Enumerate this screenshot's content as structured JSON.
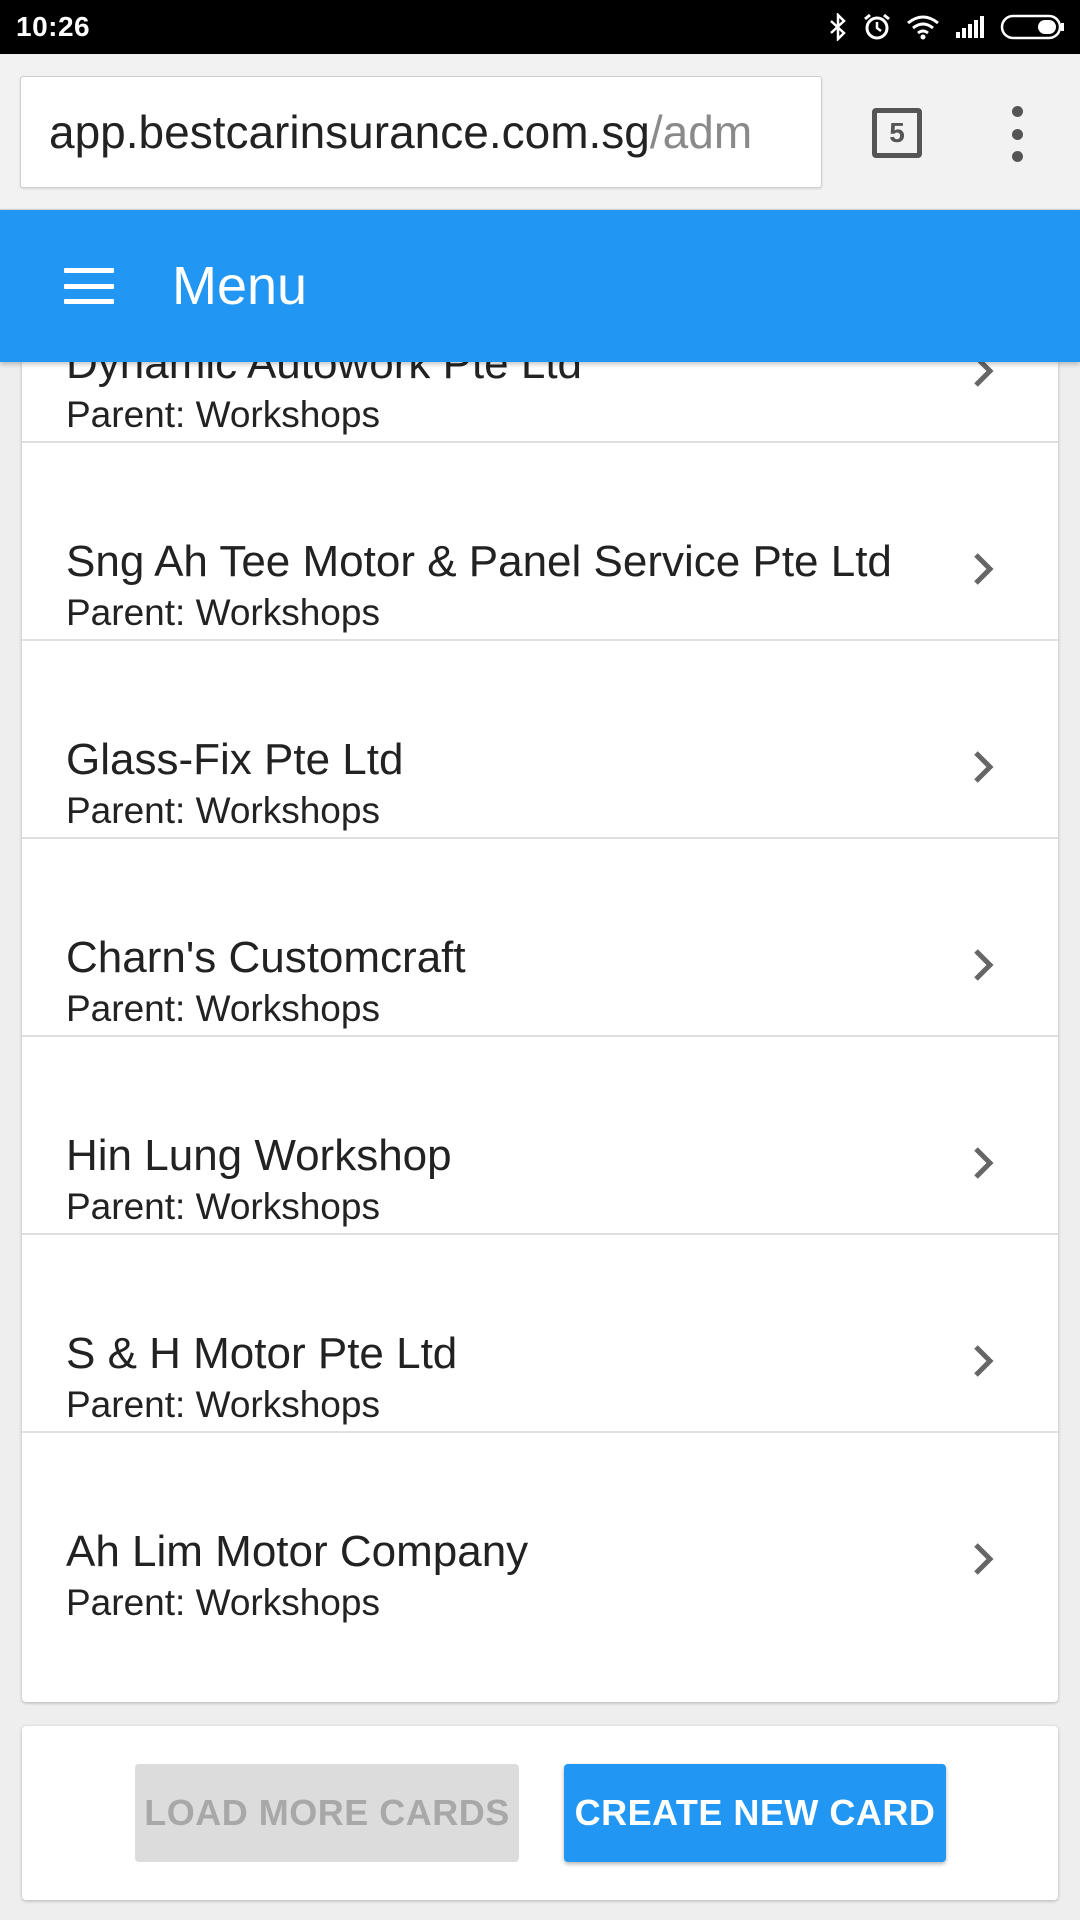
{
  "status_bar": {
    "time": "10:26"
  },
  "browser": {
    "url_host": "app.bestcarinsurance.com.sg",
    "url_rest": "/adm",
    "tab_count": "5"
  },
  "app_bar": {
    "title": "Menu"
  },
  "list": {
    "items": [
      {
        "title": "Dynamic Autowork Pte Ltd",
        "subtitle": "Parent: Workshops"
      },
      {
        "title": "Sng Ah Tee Motor & Panel Service Pte Ltd",
        "subtitle": "Parent: Workshops"
      },
      {
        "title": "Glass-Fix Pte Ltd",
        "subtitle": "Parent: Workshops"
      },
      {
        "title": "Charn's Customcraft",
        "subtitle": "Parent: Workshops"
      },
      {
        "title": "Hin Lung Workshop",
        "subtitle": "Parent: Workshops"
      },
      {
        "title": "S & H Motor Pte Ltd",
        "subtitle": "Parent: Workshops"
      },
      {
        "title": "Ah Lim Motor Company",
        "subtitle": "Parent: Workshops"
      }
    ]
  },
  "actions": {
    "load_more_label": "LOAD MORE CARDS",
    "create_label": "CREATE NEW CARD"
  },
  "colors": {
    "accent": "#2196f3",
    "disabled_button": "#dcdcdc"
  },
  "icons": {
    "menu": "hamburger-icon",
    "row": "chevron-right-icon",
    "status": [
      "bluetooth-icon",
      "alarm-icon",
      "wifi-icon",
      "signal-icon",
      "battery-icon"
    ]
  }
}
